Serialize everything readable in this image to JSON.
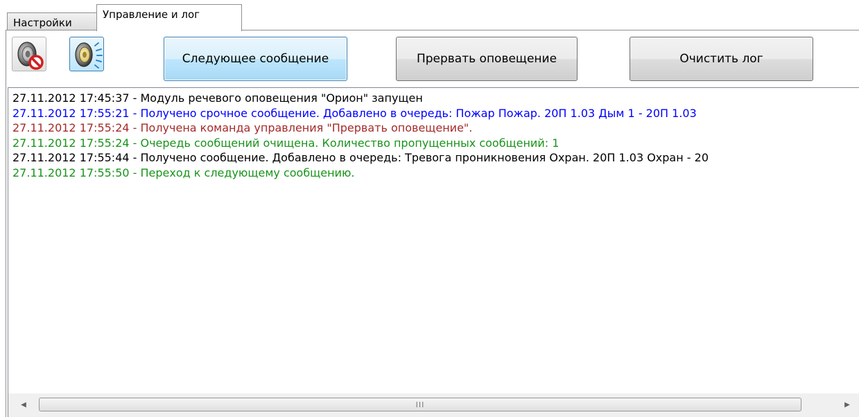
{
  "tabs": [
    {
      "label": "Настройки",
      "active": false
    },
    {
      "label": "Управление и лог",
      "active": true
    }
  ],
  "toolbar": {
    "mute_icon": "speaker-muted-icon",
    "sound_icon": "speaker-sound-icon",
    "next_label": "Следующее сообщение",
    "stop_label": "Прервать оповещение",
    "clear_label": "Очистить лог"
  },
  "log": {
    "colors": {
      "black": "#000000",
      "blue": "#0000ff",
      "red": "#a52a2a",
      "green": "#18941a"
    },
    "lines": [
      {
        "text": "27.11.2012 17:45:37 - Модуль речевого оповещения \"Орион\" запущен",
        "color": "black"
      },
      {
        "text": "27.11.2012 17:55:21 - Получено срочное сообщение. Добавлено в очередь: Пожар Пожар. 20П 1.03 Дым 1 - 20П 1.03",
        "color": "blue"
      },
      {
        "text": "27.11.2012 17:55:24 - Получена команда управления \"Прервать оповещение\".",
        "color": "red"
      },
      {
        "text": "27.11.2012 17:55:24 - Очередь сообщений очищена. Количество пропущенных сообщений: 1",
        "color": "green"
      },
      {
        "text": "27.11.2012 17:55:44 - Получено сообщение. Добавлено в очередь: Тревога проникновения Охран. 20П 1.03 Охран - 20",
        "color": "black"
      },
      {
        "text": "27.11.2012 17:55:50 - Переход к следующему сообщению.",
        "color": "green"
      }
    ]
  },
  "scrollbar": {
    "left_arrow": "◀",
    "right_arrow": "▶",
    "grip": "III"
  }
}
